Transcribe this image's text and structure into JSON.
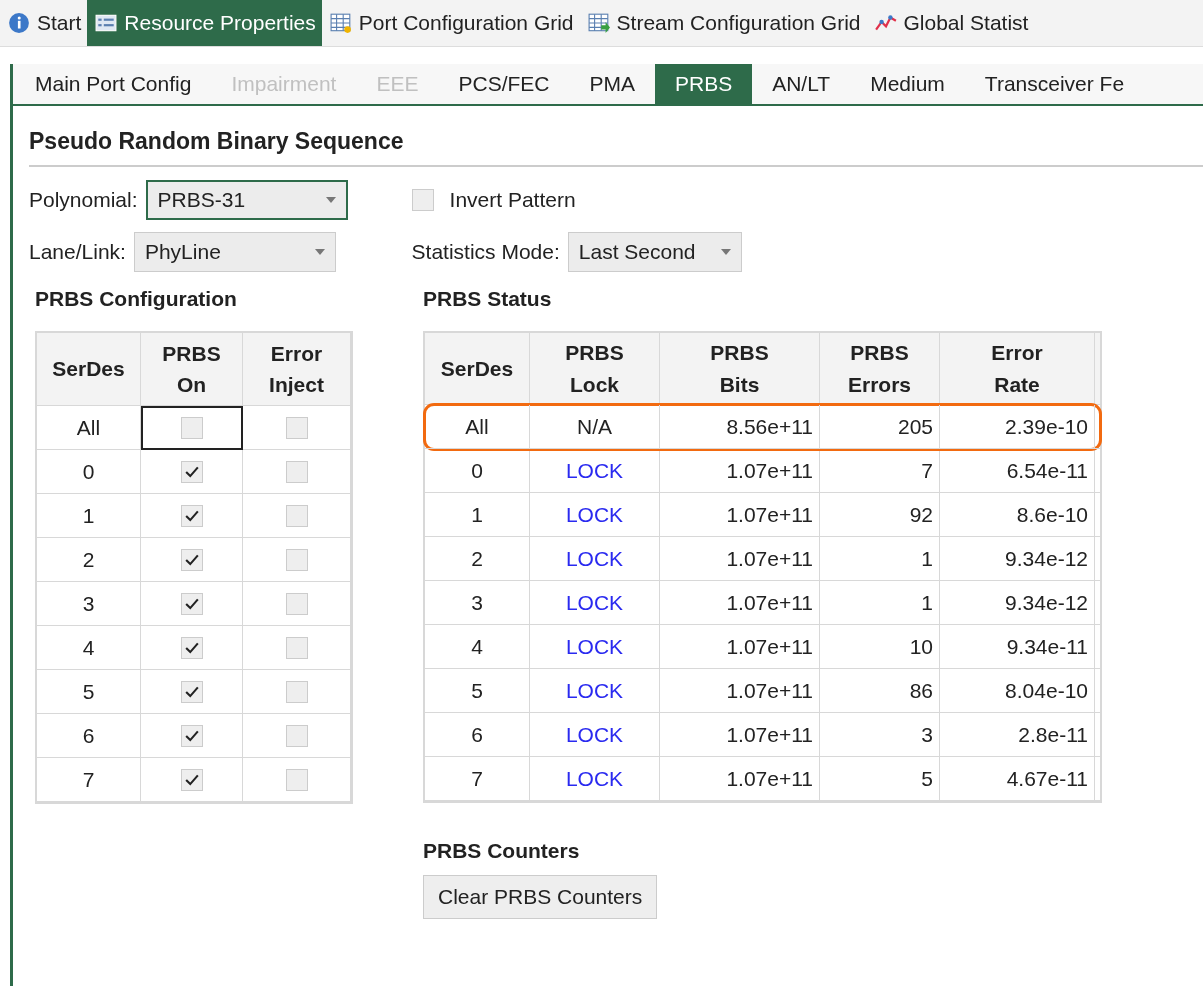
{
  "doc_tabs": [
    {
      "label": "Start",
      "selected": false
    },
    {
      "label": "Resource Properties",
      "selected": true
    },
    {
      "label": "Port Configuration Grid",
      "selected": false
    },
    {
      "label": "Stream Configuration Grid",
      "selected": false
    },
    {
      "label": "Global Statist",
      "selected": false
    }
  ],
  "sub_tabs": [
    {
      "label": "Main Port Config",
      "selected": false,
      "disabled": false
    },
    {
      "label": "Impairment",
      "selected": false,
      "disabled": true
    },
    {
      "label": "EEE",
      "selected": false,
      "disabled": true
    },
    {
      "label": "PCS/FEC",
      "selected": false,
      "disabled": false
    },
    {
      "label": "PMA",
      "selected": false,
      "disabled": false
    },
    {
      "label": "PRBS",
      "selected": true,
      "disabled": false
    },
    {
      "label": "AN/LT",
      "selected": false,
      "disabled": false
    },
    {
      "label": "Medium",
      "selected": false,
      "disabled": false
    },
    {
      "label": "Transceiver Fe",
      "selected": false,
      "disabled": false
    }
  ],
  "title": "Pseudo Random Binary Sequence",
  "polynomial": {
    "label": "Polynomial:",
    "value": "PRBS-31",
    "focused": true
  },
  "lane_link": {
    "label": "Lane/Link:",
    "value": "PhyLine",
    "focused": false
  },
  "invert_pattern": {
    "label": "Invert Pattern",
    "checked": false
  },
  "statistics_mode": {
    "label": "Statistics Mode:",
    "value": "Last Second"
  },
  "configuration": {
    "title": "PRBS Configuration",
    "columns": [
      "SerDes",
      "PRBS On",
      "Error Inject"
    ],
    "rows": [
      {
        "serdes": "All",
        "prbs_on": false,
        "focused": true,
        "error_inject": false
      },
      {
        "serdes": "0",
        "prbs_on": true,
        "focused": false,
        "error_inject": false
      },
      {
        "serdes": "1",
        "prbs_on": true,
        "focused": false,
        "error_inject": false
      },
      {
        "serdes": "2",
        "prbs_on": true,
        "focused": false,
        "error_inject": false
      },
      {
        "serdes": "3",
        "prbs_on": true,
        "focused": false,
        "error_inject": false
      },
      {
        "serdes": "4",
        "prbs_on": true,
        "focused": false,
        "error_inject": false
      },
      {
        "serdes": "5",
        "prbs_on": true,
        "focused": false,
        "error_inject": false
      },
      {
        "serdes": "6",
        "prbs_on": true,
        "focused": false,
        "error_inject": false
      },
      {
        "serdes": "7",
        "prbs_on": true,
        "focused": false,
        "error_inject": false
      }
    ]
  },
  "status": {
    "title": "PRBS Status",
    "columns": [
      "SerDes",
      "PRBS Lock",
      "PRBS Bits",
      "PRBS Errors",
      "Error Rate"
    ],
    "rows": [
      {
        "serdes": "All",
        "lock": "N/A",
        "locked": false,
        "bits": "8.56e+11",
        "errors": "205",
        "rate": "2.39e-10",
        "highlighted": true
      },
      {
        "serdes": "0",
        "lock": "LOCK",
        "locked": true,
        "bits": "1.07e+11",
        "errors": "7",
        "rate": "6.54e-11",
        "highlighted": false
      },
      {
        "serdes": "1",
        "lock": "LOCK",
        "locked": true,
        "bits": "1.07e+11",
        "errors": "92",
        "rate": "8.6e-10",
        "highlighted": false
      },
      {
        "serdes": "2",
        "lock": "LOCK",
        "locked": true,
        "bits": "1.07e+11",
        "errors": "1",
        "rate": "9.34e-12",
        "highlighted": false
      },
      {
        "serdes": "3",
        "lock": "LOCK",
        "locked": true,
        "bits": "1.07e+11",
        "errors": "1",
        "rate": "9.34e-12",
        "highlighted": false
      },
      {
        "serdes": "4",
        "lock": "LOCK",
        "locked": true,
        "bits": "1.07e+11",
        "errors": "10",
        "rate": "9.34e-11",
        "highlighted": false
      },
      {
        "serdes": "5",
        "lock": "LOCK",
        "locked": true,
        "bits": "1.07e+11",
        "errors": "86",
        "rate": "8.04e-10",
        "highlighted": false
      },
      {
        "serdes": "6",
        "lock": "LOCK",
        "locked": true,
        "bits": "1.07e+11",
        "errors": "3",
        "rate": "2.8e-11",
        "highlighted": false
      },
      {
        "serdes": "7",
        "lock": "LOCK",
        "locked": true,
        "bits": "1.07e+11",
        "errors": "5",
        "rate": "4.67e-11",
        "highlighted": false
      }
    ]
  },
  "counters": {
    "title": "PRBS Counters",
    "button": "Clear PRBS Counters"
  }
}
